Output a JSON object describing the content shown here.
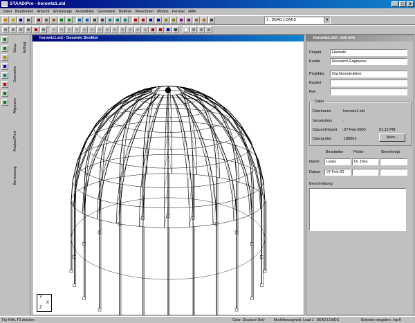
{
  "app": {
    "title": "STAAD/Pro - horowtz1.std"
  },
  "menu": [
    "Datei",
    "Bearbeiten",
    "Ansicht",
    "Werkzeuge",
    "Auswählen",
    "Geometrie",
    "Befehle",
    "Berechnen",
    "Modus",
    "Fenster",
    "Hilfe"
  ],
  "toolbar": {
    "load_case": "1 : DEAD LOADS"
  },
  "left_tabs": [
    "Setup",
    "Geometrie",
    "Allgemein",
    "Analyse/Print",
    "Bemessung"
  ],
  "left_tab2": "Auftrag",
  "structure_window": {
    "title": "horowtz1.std - Gesamte Struktur",
    "axes": {
      "y": "Y",
      "x": "X",
      "z": "Z"
    }
  },
  "job_info": {
    "title": "horowtz1.std - Job Info",
    "projekt_label": "Projekt",
    "projekt_value": "Horowtz",
    "kunde_label": "Kunde",
    "kunde_value": "Research Engineers",
    "projektnr_label": "Projektnr.",
    "projektnr_value": "Dachkonstruktion",
    "bauteil_label": "Bauteil",
    "bauteil_value": "",
    "ref_label": "Ref.",
    "ref_value": "",
    "datei_group": "Datei",
    "dateiname_label": "Dateiname",
    "dateiname_value": "horowtz1.std",
    "verzeichnis_label": "Verzeichnis",
    "verzeichnis_value": ":",
    "datum_label": "Datum/Uhrzeit",
    "datum_value": ": 07-Feb-2000",
    "uhrzeit_value": "01:12 PM",
    "groesse_label": "Dateigröße",
    "groesse_value": ": 188063",
    "mehr_button": "Mehr...",
    "col_bearbeiter": "Bearbeiter",
    "col_pruefer": "Prüfer",
    "col_genehmigt": "Genehmigt",
    "name_label": "Name",
    "name_bearbeiter": "Lewis",
    "name_pruefer": "Dr. Dies",
    "name_genehmigt": "",
    "datum2_label": "Datum",
    "datum_bearbeiter": "07-Feb-00",
    "beschreibung_label": "Beschreibung"
  },
  "status": {
    "help": "Für Hilfe, F1 drücken.",
    "display": "Color: Structure Only",
    "mode": "Modellierungmodi: Load 1 : DEAD LOADS",
    "units": "Einheiten eingeben : kip-ft"
  }
}
